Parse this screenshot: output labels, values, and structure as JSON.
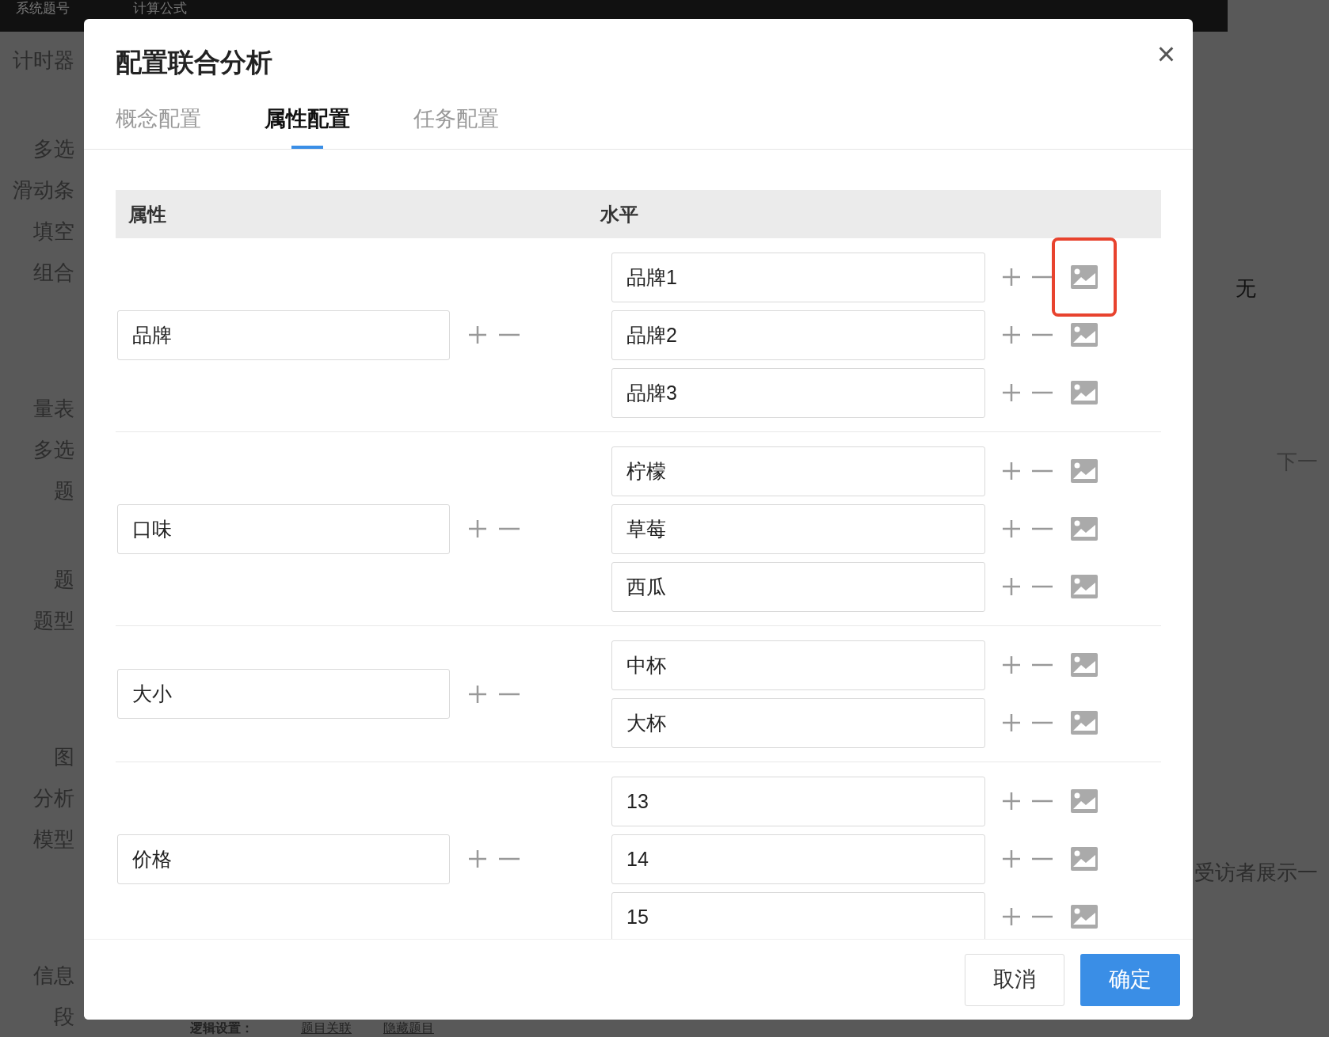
{
  "background": {
    "top_bar": [
      "系统题号",
      "计算公式"
    ],
    "sidebar_items": [
      "计时器",
      "多选",
      "滑动条",
      "填空",
      "组合",
      "量表",
      "多选",
      "题",
      "题",
      "题型",
      "图",
      "分析",
      "模型",
      "信息",
      "段"
    ],
    "right_texts": [
      "无",
      "下一",
      "受访者展示一"
    ],
    "bottom": {
      "label": "逻辑设置：",
      "links": [
        "题目关联",
        "隐藏题目"
      ]
    }
  },
  "dialog": {
    "title": "配置联合分析",
    "close": "×",
    "tabs": [
      {
        "label": "概念配置",
        "selected": false
      },
      {
        "label": "属性配置",
        "selected": true
      },
      {
        "label": "任务配置",
        "selected": false
      }
    ],
    "table": {
      "columns": [
        "属性",
        "水平"
      ],
      "rows": [
        {
          "attribute": "品牌",
          "levels": [
            {
              "value": "品牌1",
              "highlighted": true
            },
            {
              "value": "品牌2",
              "highlighted": false
            },
            {
              "value": "品牌3",
              "highlighted": false
            }
          ]
        },
        {
          "attribute": "口味",
          "levels": [
            {
              "value": "柠檬",
              "highlighted": false
            },
            {
              "value": "草莓",
              "highlighted": false
            },
            {
              "value": "西瓜",
              "highlighted": false
            }
          ]
        },
        {
          "attribute": "大小",
          "levels": [
            {
              "value": "中杯",
              "highlighted": false
            },
            {
              "value": "大杯",
              "highlighted": false
            }
          ]
        },
        {
          "attribute": "价格",
          "levels": [
            {
              "value": "13",
              "highlighted": false
            },
            {
              "value": "14",
              "highlighted": false
            },
            {
              "value": "15",
              "highlighted": false
            }
          ]
        }
      ]
    },
    "buttons": [
      {
        "label": "取消",
        "kind": "secondary"
      },
      {
        "label": "确定",
        "kind": "primary"
      }
    ]
  }
}
